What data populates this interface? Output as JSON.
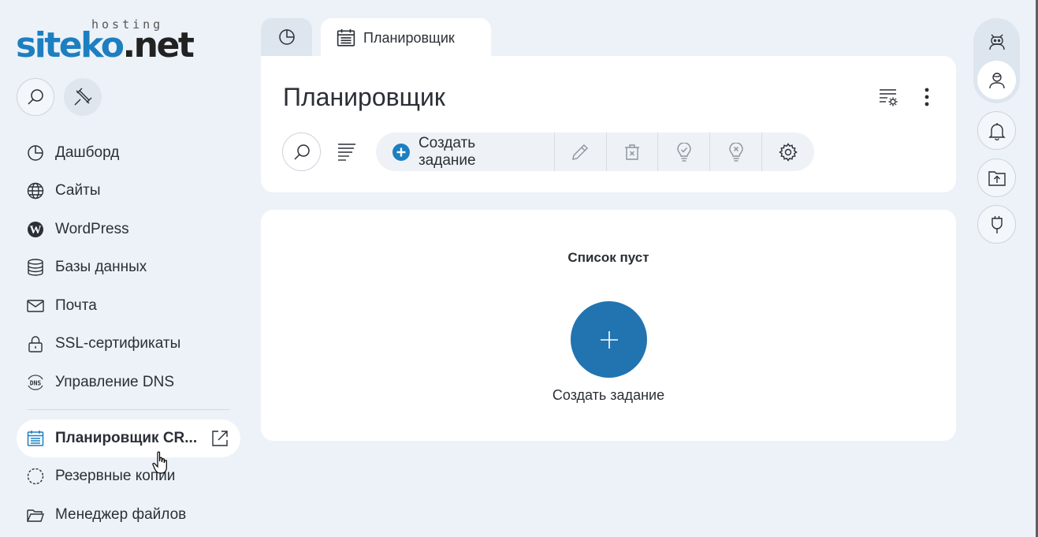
{
  "brand": {
    "logo_main_a": "siteko",
    "logo_main_b": ".net",
    "logo_sub": "hosting",
    "accent": "#1d7fc0"
  },
  "sidebar": {
    "items": [
      {
        "label": "Дашборд",
        "icon": "pie-chart-icon"
      },
      {
        "label": "Сайты",
        "icon": "globe-icon"
      },
      {
        "label": "WordPress",
        "icon": "wordpress-icon"
      },
      {
        "label": "Базы данных",
        "icon": "database-icon"
      },
      {
        "label": "Почта",
        "icon": "mail-icon"
      },
      {
        "label": "SSL-сертификаты",
        "icon": "lock-icon"
      },
      {
        "label": "Управление DNS",
        "icon": "dns-icon"
      },
      {
        "label": "Планировщик CR...",
        "icon": "calendar-icon",
        "active": true
      },
      {
        "label": "Резервные копии",
        "icon": "backup-icon"
      },
      {
        "label": "Менеджер файлов",
        "icon": "folder-icon"
      }
    ],
    "dns_icon_text": "DNS"
  },
  "tabs": [
    {
      "label": "",
      "icon": "pie-chart-icon"
    },
    {
      "label": "Планировщик",
      "icon": "calendar-icon",
      "active": true
    }
  ],
  "header": {
    "title": "Планировщик"
  },
  "toolbar": {
    "create_label": "Создать задание",
    "icons": [
      "edit-icon",
      "delete-icon",
      "enable-icon",
      "disable-icon",
      "settings-icon"
    ]
  },
  "content": {
    "empty_title": "Список пуст",
    "create_label": "Создать задание",
    "button_color": "#2174b0"
  },
  "right_rail": [
    "bot-icon",
    "user-icon",
    "bell-icon",
    "upload-folder-icon",
    "plug-icon"
  ]
}
